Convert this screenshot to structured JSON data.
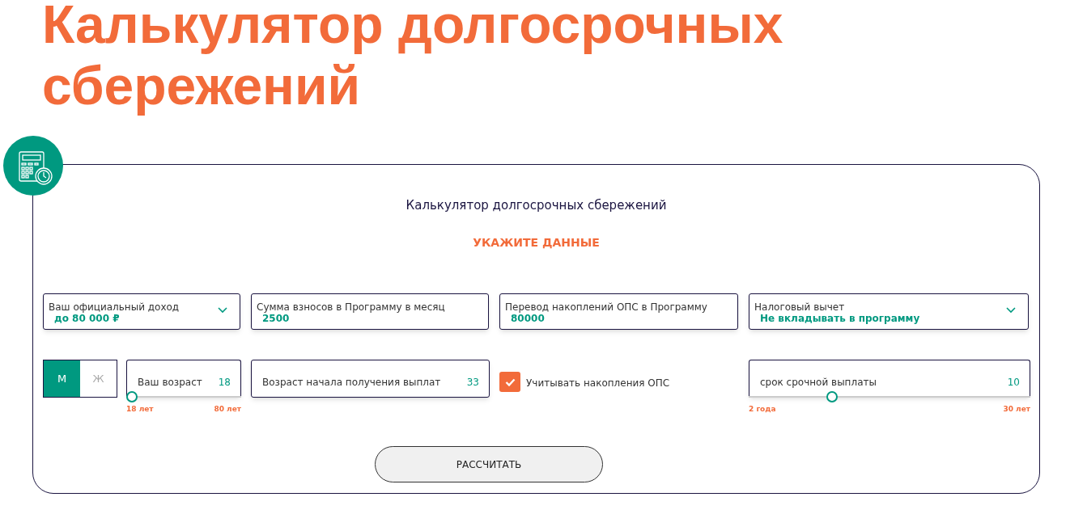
{
  "page_title": "Калькулятор долгосрочных сбережений",
  "card": {
    "title": "Калькулятор долгосрочных сбережений",
    "subtitle": "УКАЖИТЕ ДАННЫЕ",
    "fields": [
      {
        "kind": "dropdown",
        "label": "Ваш официальный доход",
        "value": "до 80 000 ₽"
      },
      {
        "kind": "input",
        "label": "Сумма взносов в Программу в месяц",
        "value": "2500"
      },
      {
        "kind": "input",
        "label": "Перевод накоплений ОПС в Программу",
        "value": "80000"
      },
      {
        "kind": "dropdown",
        "label": "Налоговый вычет",
        "value": "Не вкладывать в программу"
      }
    ],
    "gender": [
      {
        "label": "М",
        "selected": true
      },
      {
        "label": "Ж",
        "selected": false
      }
    ],
    "age": {
      "label": "Ваш возраст",
      "value": "18",
      "level": 0,
      "min_label": "18 лет",
      "max_label": "80 лет"
    },
    "payout_age": {
      "label": "Возраст начала получения выплат",
      "value": "33"
    },
    "ops_checkbox": {
      "label": "Учитывать накопления ОПС",
      "checked": true
    },
    "term": {
      "label": "срок срочной выплаты",
      "value": "10",
      "level": 0.286,
      "min_label": "2 года",
      "max_label": "30 лет"
    },
    "button": "РАССЧИТАТЬ"
  }
}
